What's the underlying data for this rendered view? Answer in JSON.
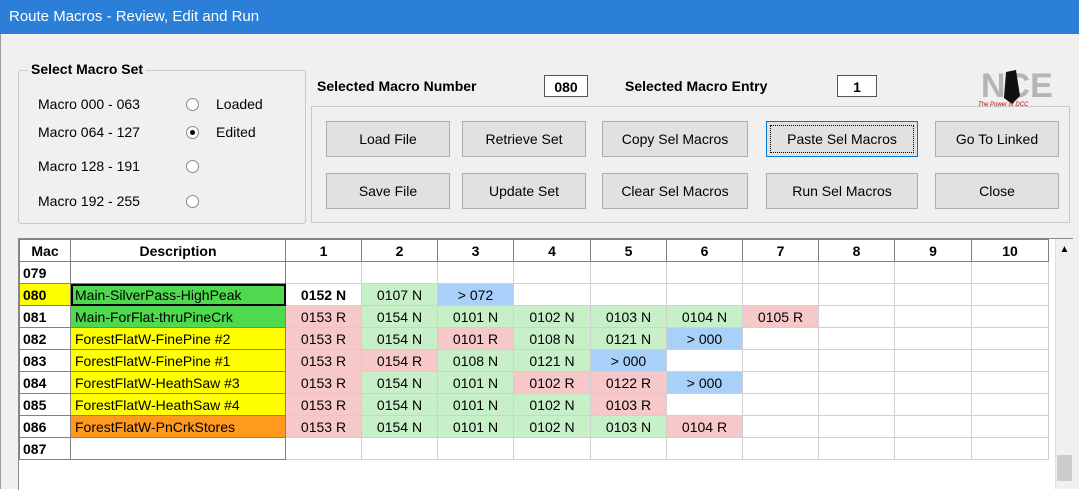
{
  "window": {
    "title": "Route Macros - Review, Edit and Run"
  },
  "macro_set": {
    "title": "Select Macro Set",
    "options": [
      {
        "label": "Macro 000 - 063",
        "status": "Loaded",
        "selected": false
      },
      {
        "label": "Macro 064 - 127",
        "status": "Edited",
        "selected": true
      },
      {
        "label": "Macro 128 - 191",
        "status": "",
        "selected": false
      },
      {
        "label": "Macro 192 - 255",
        "status": "",
        "selected": false
      }
    ]
  },
  "selection": {
    "macro_number_label": "Selected Macro Number",
    "macro_number": "080",
    "macro_entry_label": "Selected Macro Entry",
    "macro_entry": "1"
  },
  "buttons": {
    "load_file": "Load File",
    "retrieve_set": "Retrieve Set",
    "copy_sel_macros": "Copy Sel Macros",
    "paste_sel_macros": "Paste Sel Macros",
    "go_to_linked": "Go To Linked",
    "save_file": "Save File",
    "update_set": "Update Set",
    "clear_sel_macros": "Clear Sel Macros",
    "run_sel_macros": "Run Sel Macros",
    "close": "Close"
  },
  "logo": {
    "text": "NCE",
    "tagline": "The Power of DCC"
  },
  "colors": {
    "title_bar": "#2b7fd6",
    "normal": "#c8f0c8",
    "reverse": "#f7c8c8",
    "link": "#a8d0f8",
    "desc_yellow": "#ffff00",
    "desc_green": "#4ed94e",
    "desc_orange": "#ff9a1f"
  },
  "grid": {
    "columns": [
      "Mac",
      "Description",
      "1",
      "2",
      "3",
      "4",
      "5",
      "6",
      "7",
      "8",
      "9",
      "10"
    ],
    "rows": [
      {
        "mac": "079",
        "desc": "",
        "desc_color": "",
        "cells": []
      },
      {
        "mac": "080",
        "desc": "Main-SilverPass-HighPeak",
        "desc_color": "green",
        "mac_highlight": true,
        "cells": [
          "0152 N",
          "0107 N",
          "> 072"
        ]
      },
      {
        "mac": "081",
        "desc": "Main-ForFlat-thruPineCrk",
        "desc_color": "green",
        "cells": [
          "0153 R",
          "0154 N",
          "0101 N",
          "0102 N",
          "0103 N",
          "0104 N",
          "0105 R"
        ]
      },
      {
        "mac": "082",
        "desc": "ForestFlatW-FinePine #2",
        "desc_color": "yellow",
        "cells": [
          "0153 R",
          "0154 N",
          "0101 R",
          "0108 N",
          "0121 N",
          "> 000"
        ]
      },
      {
        "mac": "083",
        "desc": "ForestFlatW-FinePine #1",
        "desc_color": "yellow",
        "cells": [
          "0153 R",
          "0154 R",
          "0108 N",
          "0121 N",
          "> 000"
        ]
      },
      {
        "mac": "084",
        "desc": "ForestFlatW-HeathSaw #3",
        "desc_color": "yellow",
        "cells": [
          "0153 R",
          "0154 N",
          "0101 N",
          "0102 R",
          "0122 R",
          "> 000"
        ]
      },
      {
        "mac": "085",
        "desc": "ForestFlatW-HeathSaw #4",
        "desc_color": "yellow",
        "cells": [
          "0153 R",
          "0154 N",
          "0101 N",
          "0102 N",
          "0103 R"
        ]
      },
      {
        "mac": "086",
        "desc": "ForestFlatW-PnCrkStores",
        "desc_color": "orange",
        "cells": [
          "0153 R",
          "0154 N",
          "0101 N",
          "0102 N",
          "0103 N",
          "0104 R"
        ]
      },
      {
        "mac": "087",
        "desc": "",
        "desc_color": "",
        "cells": []
      }
    ]
  }
}
